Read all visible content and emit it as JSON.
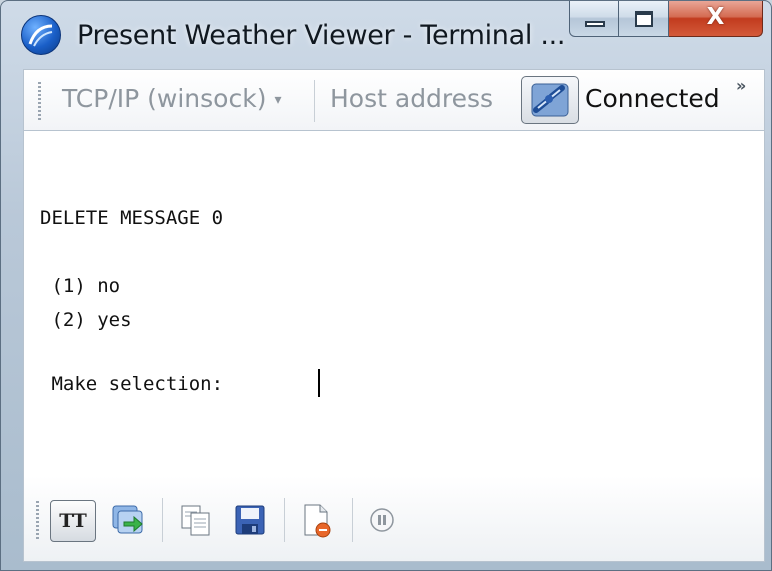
{
  "window": {
    "title": "Present Weather Viewer - Terminal ..."
  },
  "caption": {
    "minimize_icon": "minimize-icon",
    "maximize_icon": "maximize-icon",
    "close_glyph": "X"
  },
  "connection": {
    "protocol": "TCP/IP (winsock)",
    "protocol_caret": "▾",
    "host_address_placeholder": "Host address",
    "status": "Connected",
    "overflow": "»"
  },
  "terminal": {
    "lines": [
      "DELETE MESSAGE 0",
      " (1) no",
      " (2) yes",
      " Make selection: "
    ]
  },
  "bottom_toolbar": {
    "tt_label": "TT",
    "icons": [
      "tt-toggle-icon",
      "send-file-icon",
      "copy-icon",
      "save-icon",
      "new-log-icon",
      "pause-icon"
    ]
  },
  "colors": {
    "close_red": "#c23b1e",
    "title_text": "#101820",
    "disabled_text": "#8e969e"
  }
}
